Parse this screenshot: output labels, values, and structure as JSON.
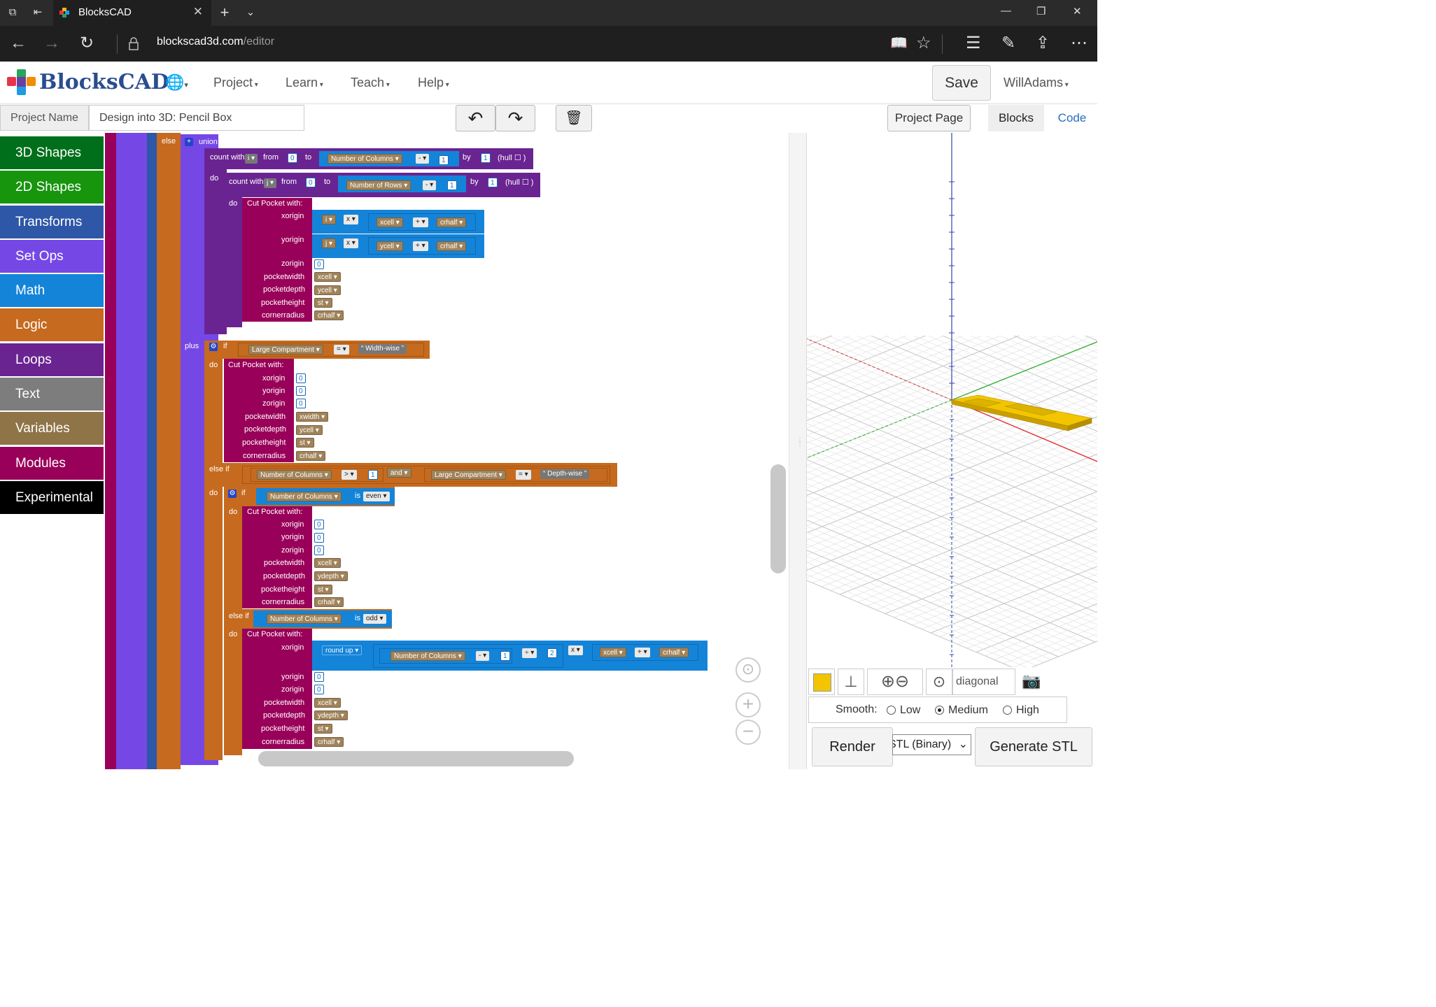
{
  "browser": {
    "tab_title": "BlocksCAD",
    "url_host": "blockscad3d.com",
    "url_path": "/editor"
  },
  "header": {
    "logo": "BlocksCAD",
    "menus": [
      "Project",
      "Learn",
      "Teach",
      "Help"
    ],
    "save_label": "Save",
    "user": "WillAdams"
  },
  "project": {
    "name_label": "Project Name",
    "name_value": "Design into 3D: Pencil Box",
    "project_page": "Project Page",
    "tab_blocks": "Blocks",
    "tab_code": "Code"
  },
  "categories": [
    {
      "label": "3D Shapes",
      "color": "#006f1b"
    },
    {
      "label": "2D Shapes",
      "color": "#16950d"
    },
    {
      "label": "Transforms",
      "color": "#2e57a7"
    },
    {
      "label": "Set Ops",
      "color": "#7548e6"
    },
    {
      "label": "Math",
      "color": "#1484d9"
    },
    {
      "label": "Logic",
      "color": "#c56a1f"
    },
    {
      "label": "Loops",
      "color": "#6a2491"
    },
    {
      "label": "Text",
      "color": "#7d7d7d"
    },
    {
      "label": "Variables",
      "color": "#8f7447"
    },
    {
      "label": "Modules",
      "color": "#990059"
    },
    {
      "label": "Experimental",
      "color": "#000000"
    }
  ],
  "blocks": {
    "else": "else",
    "union": "union",
    "count_with": "count with",
    "from": "from",
    "to": "to",
    "by": "by",
    "hull": "(hull",
    "do": "do",
    "plus": "plus",
    "if": "if",
    "else_if": "else if",
    "and": "and",
    "is": "is",
    "cut_pocket": "Cut Pocket  with:",
    "xorigin": "xorigin",
    "yorigin": "yorigin",
    "zorigin": "zorigin",
    "pocketwidth": "pocketwidth",
    "pocketdepth": "pocketdepth",
    "pocketheight": "pocketheight",
    "cornerradius": "cornerradius",
    "round_up": "round up",
    "var_i": "i",
    "var_j": "j",
    "num_columns": "Number of Columns",
    "num_rows": "Number of Rows",
    "large_comp": "Large Compartment",
    "width_wise": "Width-wise",
    "depth_wise": "Depth-wise",
    "even": "even",
    "odd": "odd",
    "xcell": "xcell",
    "ycell": "ycell",
    "crhalf": "crhalf",
    "st": "st",
    "xwidth": "xwidth",
    "ydepth": "ydepth",
    "one": "1",
    "two": "2",
    "zero": "0",
    "op_minus": "-",
    "op_plus": "+",
    "op_times": "x",
    "op_div": "÷",
    "op_eq": "=",
    "op_gt": ">"
  },
  "viewer": {
    "view_mode": "diagonal",
    "object_color": "#f2c500",
    "smooth_label": "Smooth:",
    "smooth_options": [
      "Low",
      "Medium",
      "High"
    ],
    "smooth_selected": "Medium",
    "render": "Render",
    "format": "STL (Binary)",
    "generate": "Generate STL"
  }
}
